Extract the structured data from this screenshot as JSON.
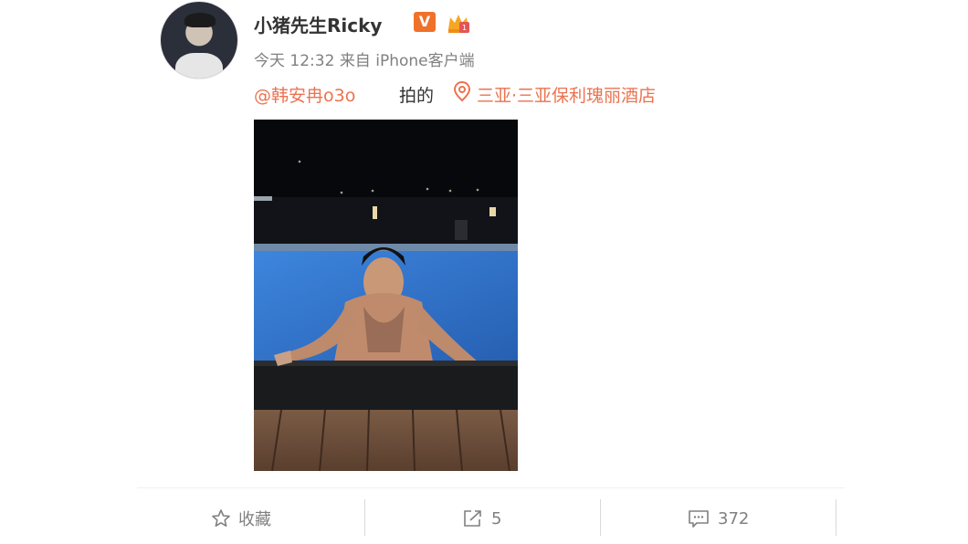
{
  "post": {
    "username": "小猪先生Ricky",
    "verified_badge": "V",
    "time": "今天 12:32",
    "source": "来自 iPhone客户端",
    "mention": "@韩安冉o3o",
    "caption": "拍的",
    "location": "三亚·三亚保利瑰丽酒店"
  },
  "actions": {
    "favorite_label": "收藏",
    "repost_count": "5",
    "comment_count": "372"
  },
  "colors": {
    "link": "#eb7350",
    "badge": "#f0712a",
    "muted": "#808080"
  },
  "icons": [
    "avatar",
    "verified-v-icon",
    "vip-crown-icon",
    "location-pin-icon",
    "star-icon",
    "share-icon",
    "comment-icon"
  ]
}
